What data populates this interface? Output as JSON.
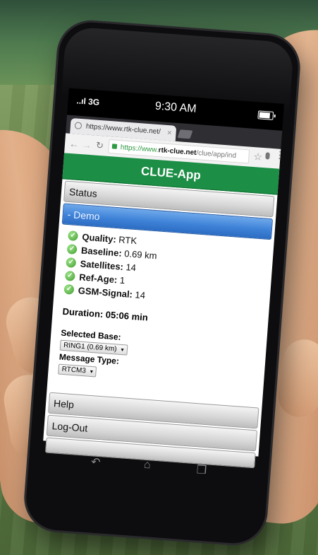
{
  "status_bar": {
    "signal": "..ıl 3G",
    "time": "9:30 AM",
    "battery_icon": "battery-icon"
  },
  "browser": {
    "tab_title": "https://www.rtk-clue.net/",
    "tab_close": "×",
    "url_https": "https://www.",
    "url_host": "rtk-clue.net",
    "url_rest": "/clue/app/ind"
  },
  "app": {
    "title": "CLUE-App",
    "sections": {
      "status": "Status",
      "demo": "- Demo",
      "help": "Help",
      "logout": "Log-Out"
    },
    "metrics": [
      {
        "label": "Quality:",
        "value": "RTK"
      },
      {
        "label": "Baseline:",
        "value": "0.69 km"
      },
      {
        "label": "Satellites:",
        "value": "14"
      },
      {
        "label": "Ref-Age:",
        "value": "1"
      },
      {
        "label": "GSM-Signal:",
        "value": "14"
      }
    ],
    "duration": "Duration: 05:06 min",
    "selected_base_label": "Selected Base:",
    "selected_base_value": "RING1 (0.69 km)",
    "message_type_label": "Message Type:",
    "message_type_value": "RTCM3"
  },
  "nav_bar": {
    "back_icon": "back-icon",
    "home_icon": "home-icon",
    "recent_icon": "recent-apps-icon"
  },
  "colors": {
    "header_green": "#1c8e45",
    "demo_blue": "#3e82d8"
  }
}
